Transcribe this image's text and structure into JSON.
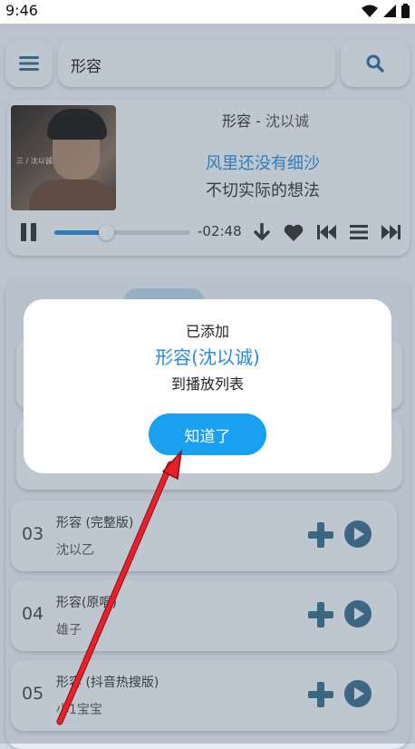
{
  "status": {
    "time": "9:46"
  },
  "search": {
    "value": "形容"
  },
  "player": {
    "title": "形容",
    "separator": " - ",
    "artist": "沈以诚",
    "lyric_current": "风里还没有细沙",
    "lyric_next": "不切实际的想法",
    "remaining": "-02:48",
    "progress": 0.38,
    "cover_text": "三 / 沈以诚"
  },
  "list": {
    "rows": [
      {
        "num": "03",
        "title": "形容 (完整版)",
        "artist": "沈以乙"
      },
      {
        "num": "04",
        "title": "形容(原唱)",
        "artist": "雄子"
      },
      {
        "num": "05",
        "title": "形容 (抖音热搜版)",
        "artist": "小1宝宝"
      }
    ]
  },
  "dialog": {
    "line1": "已添加",
    "song": "形容(沈以诚)",
    "line3": "到播放列表",
    "ok_label": "知道了"
  },
  "colors": {
    "accent": "#2a8bd8",
    "button": "#1aa0f0",
    "icon": "#3a6e8e",
    "arrow": "#e8202a"
  }
}
